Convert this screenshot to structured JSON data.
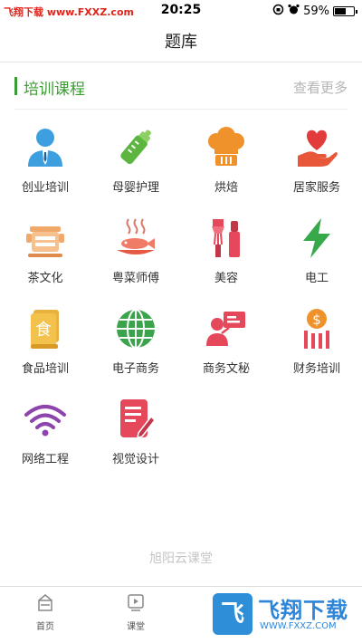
{
  "status_bar": {
    "watermark": "飞翔下载 www.FXXZ.com",
    "time": "20:25",
    "battery": "59%",
    "battery_level": 0.59
  },
  "header": {
    "title": "题库"
  },
  "section": {
    "title": "培训课程",
    "more": "查看更多"
  },
  "courses": [
    {
      "label": "创业培训",
      "icon": "businessman-icon"
    },
    {
      "label": "母婴护理",
      "icon": "baby-bottle-icon"
    },
    {
      "label": "烘焙",
      "icon": "chef-hat-icon"
    },
    {
      "label": "居家服务",
      "icon": "heart-hand-icon"
    },
    {
      "label": "茶文化",
      "icon": "tea-pot-icon"
    },
    {
      "label": "粤菜师傅",
      "icon": "fish-dish-icon"
    },
    {
      "label": "美容",
      "icon": "cosmetics-icon"
    },
    {
      "label": "电工",
      "icon": "lightning-icon"
    },
    {
      "label": "食品培训",
      "icon": "food-book-icon"
    },
    {
      "label": "电子商务",
      "icon": "globe-icon"
    },
    {
      "label": "商务文秘",
      "icon": "presenter-icon"
    },
    {
      "label": "财务培训",
      "icon": "money-icon"
    },
    {
      "label": "网络工程",
      "icon": "wifi-icon"
    },
    {
      "label": "视觉设计",
      "icon": "design-doc-icon"
    }
  ],
  "footer": {
    "brand": "旭阳云课堂"
  },
  "tabbar": [
    {
      "label": "首页",
      "icon": "home-icon"
    },
    {
      "label": "课堂",
      "icon": "video-play-icon"
    }
  ],
  "watermark_bottom": {
    "text": "飞翔下载",
    "url": "WWW.FXXZ.COM",
    "logo_letter": "飞"
  }
}
